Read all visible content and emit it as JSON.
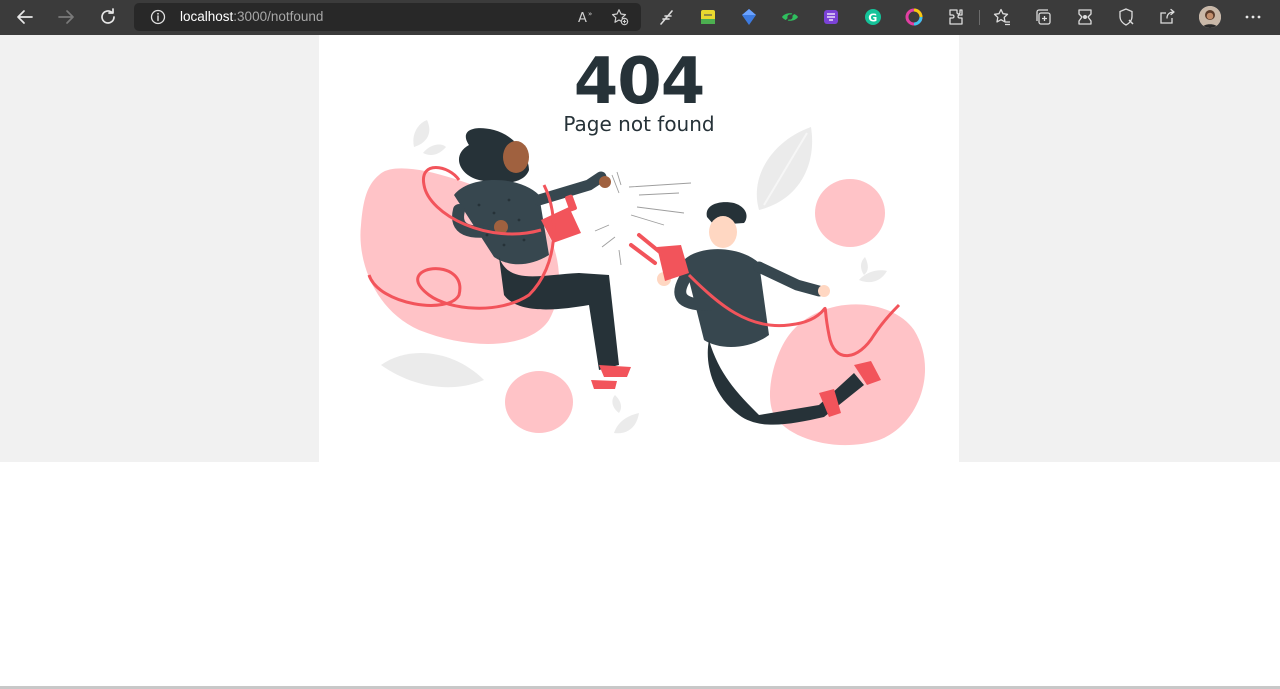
{
  "browser": {
    "url_host": "localhost",
    "url_path": ":3000/notfound"
  },
  "page": {
    "error_code": "404",
    "error_message": "Page not found"
  },
  "colors": {
    "accent": "#f2545b",
    "blob": "#ffc3c7",
    "dark": "#263238",
    "leaf": "#ebebeb"
  },
  "icons": [
    "back-icon",
    "forward-icon",
    "refresh-icon",
    "info-icon",
    "read-aloud-icon",
    "favorite-add-icon",
    "extensions-icon",
    "favorites-icon",
    "collections-icon",
    "browser-essentials-icon",
    "share-icon",
    "more-icon"
  ]
}
